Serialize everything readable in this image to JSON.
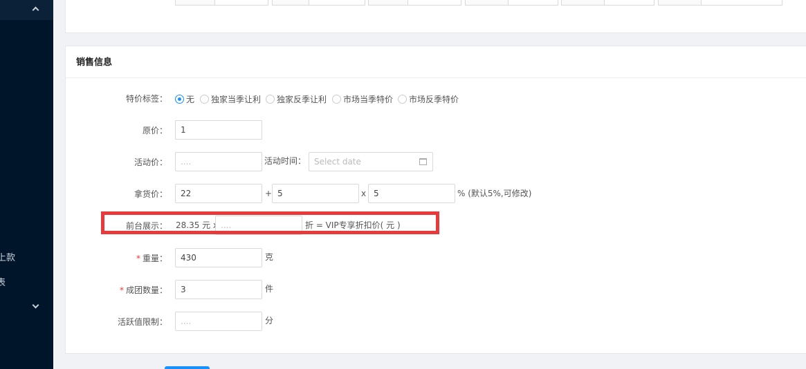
{
  "sidebar": {
    "items": [
      {
        "label": "上款"
      },
      {
        "label": "表"
      }
    ]
  },
  "section": {
    "title": "销售信息"
  },
  "form": {
    "price_tag": {
      "label": "特价标签：",
      "options": [
        "无",
        "独家当季让利",
        "独家反季让利",
        "市场当季特价",
        "市场反季特价"
      ],
      "selected": "无"
    },
    "original_price": {
      "label": "原价：",
      "value": "1"
    },
    "activity_price": {
      "label": "活动价：",
      "placeholder": "...."
    },
    "activity_time": {
      "label": "活动时间：",
      "placeholder": "Select date"
    },
    "cost_price": {
      "label": "拿货价：",
      "base": "22",
      "plus_sign": "+",
      "add": "5",
      "times_sign": "x",
      "rate": "5",
      "suffix": "% (默认5%,可修改)"
    },
    "front_display": {
      "label": "前台展示：",
      "prefix": "28.35 元 x",
      "placeholder": "....",
      "suffix": "折 = VIP专享折扣价( 元 )"
    },
    "weight": {
      "required_mark": "*",
      "label": "重量：",
      "value": "430",
      "unit": "克"
    },
    "group_qty": {
      "required_mark": "*",
      "label": "成团数量：",
      "value": "3",
      "unit": "件"
    },
    "activity_limit": {
      "label": "活跃值限制：",
      "placeholder": "....",
      "unit": "分"
    }
  },
  "colors": {
    "accent": "#1890ff",
    "highlight": "#e83a3a",
    "sidebar": "#001529"
  }
}
